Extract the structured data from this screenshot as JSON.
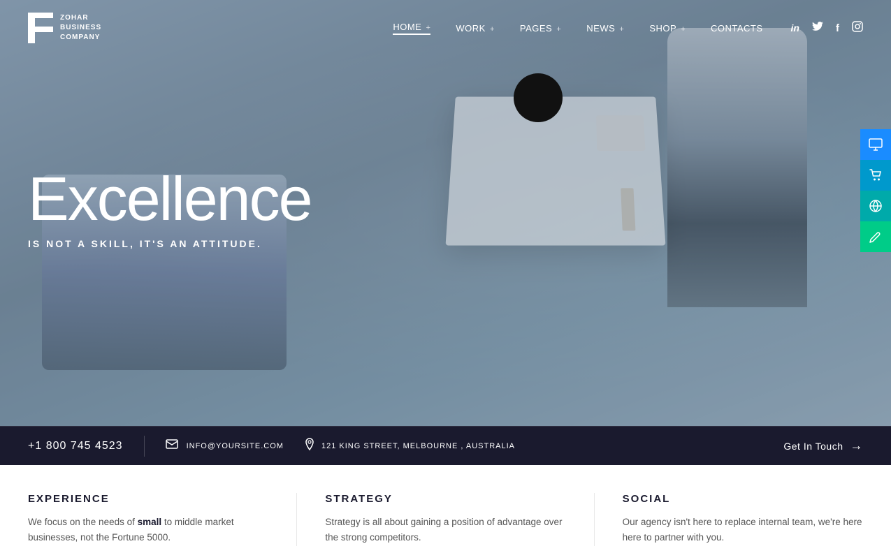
{
  "logo": {
    "line1": "ZOHAR",
    "line2": "BUSINESS",
    "line3": "COMPANY"
  },
  "nav": {
    "items": [
      {
        "label": "HOME",
        "has_plus": true,
        "active": true
      },
      {
        "label": "WORK",
        "has_plus": true,
        "active": false
      },
      {
        "label": "PAGES",
        "has_plus": true,
        "active": false
      },
      {
        "label": "NEWS",
        "has_plus": true,
        "active": false
      },
      {
        "label": "SHOP",
        "has_plus": true,
        "active": false
      },
      {
        "label": "CONTACTS",
        "has_plus": false,
        "active": false
      }
    ]
  },
  "social": {
    "linkedin": "in",
    "twitter": "🐦",
    "facebook": "f",
    "instagram": "📷"
  },
  "hero": {
    "title": "Excellence",
    "subtitle": "IS NOT A SKILL, IT'S AN ATTITUDE."
  },
  "contact_bar": {
    "phone": "+1 800 745 4523",
    "email": "INFO@YOURSITE.COM",
    "address": "121 KING STREET, MELBOURNE , AUSTRALIA",
    "cta": "Get In Touch"
  },
  "sidebar_buttons": [
    {
      "icon": "🖥",
      "color": "blue",
      "name": "monitor"
    },
    {
      "icon": "🛒",
      "color": "teal",
      "name": "cart"
    },
    {
      "icon": "🌐",
      "color": "green-teal",
      "name": "globe"
    },
    {
      "icon": "✏",
      "color": "green",
      "name": "edit"
    }
  ],
  "info_cols": [
    {
      "title": "EXPERIENCE",
      "text_parts": [
        "We focus on the needs of ",
        "small",
        " to middle market businesses, not the Fortune 5000."
      ],
      "has_link": false
    },
    {
      "title": "STRATEGY",
      "text": "Strategy is all about gaining a position of advantage over the strong competitors.",
      "has_link": false
    },
    {
      "title": "SOCIAL",
      "text": "Our agency isn't here to replace internal team, we're here here to partner with you.",
      "has_link": false
    }
  ]
}
